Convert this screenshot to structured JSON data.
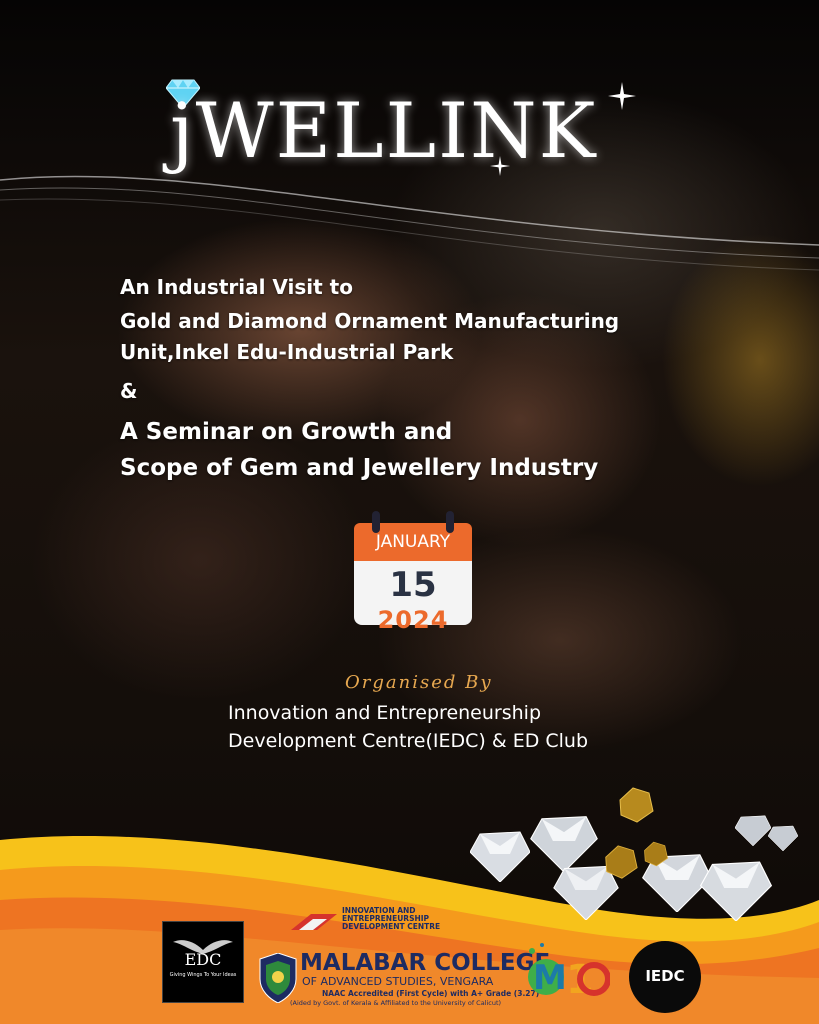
{
  "title": "jWELLINK",
  "headline": {
    "line1": "An Industrial Visit to",
    "line2": "Gold and Diamond Ornament Manufacturing",
    "line3": "Unit,Inkel Edu-Industrial Park",
    "amp": "&",
    "line4": "A Seminar on Growth and",
    "line5": "Scope of Gem and Jewellery Industry"
  },
  "calendar": {
    "month": "JANUARY",
    "day": "15",
    "year": "2024"
  },
  "organiser": {
    "label": "Organised By",
    "line1": "Innovation and Entrepreneurship",
    "line2": "Development Centre(IEDC) & ED Club"
  },
  "footer": {
    "edc_logo": "EDC",
    "edc_tagline": "Giving Wings To Your Ideas",
    "iedc_text_line1": "INNOVATION AND",
    "iedc_text_line2": "ENTREPRENEURSHIP",
    "iedc_text_line3": "DEVELOPMENT CENTRE",
    "college_name": "MALABAR COLLEGE",
    "college_sub": "OF ADVANCED  STUDIES, VENGARA",
    "college_naac": "NAAC Accredited (First Cycle) with A+ Grade (3.27)",
    "college_aided": "(Aided by Govt. of Kerala & Affiliated to the University of Calicut)",
    "iedc_circle": "IEDC"
  },
  "colors": {
    "accent": "#ec6a2c",
    "navy": "#1d2b62",
    "gold": "#e7a850"
  }
}
